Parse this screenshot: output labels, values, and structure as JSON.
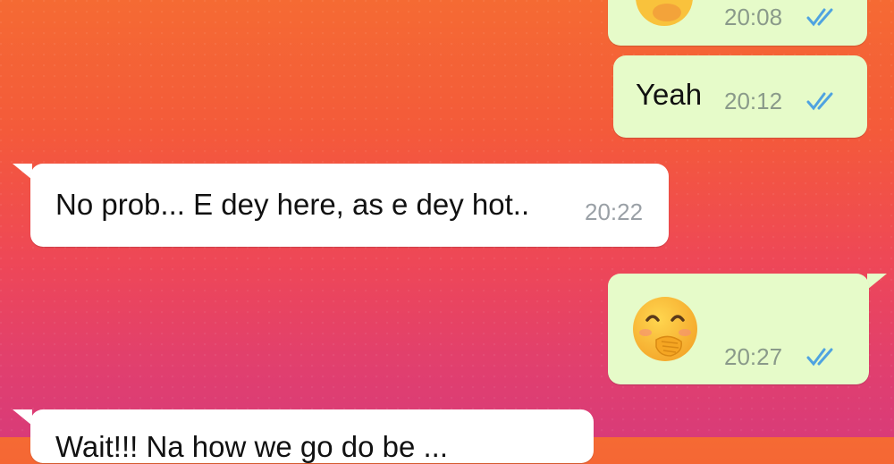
{
  "theme": {
    "outgoing_bubble": "#e6fbc9",
    "incoming_bubble": "#ffffff",
    "read_ticks": "#4fa3e0"
  },
  "messages": [
    {
      "direction": "outgoing",
      "emoji": "hand-over-mouth-face-icon",
      "time": "20:08",
      "status": "read"
    },
    {
      "direction": "outgoing",
      "text": "Yeah",
      "time": "20:12",
      "status": "read"
    },
    {
      "direction": "incoming",
      "text": "No prob... E dey here, as e dey hot..",
      "time": "20:22"
    },
    {
      "direction": "outgoing",
      "emoji": "hand-over-mouth-face-icon",
      "time": "20:27",
      "status": "read"
    },
    {
      "direction": "incoming",
      "text": "Wait!!! Na how we go do be ..."
    }
  ]
}
